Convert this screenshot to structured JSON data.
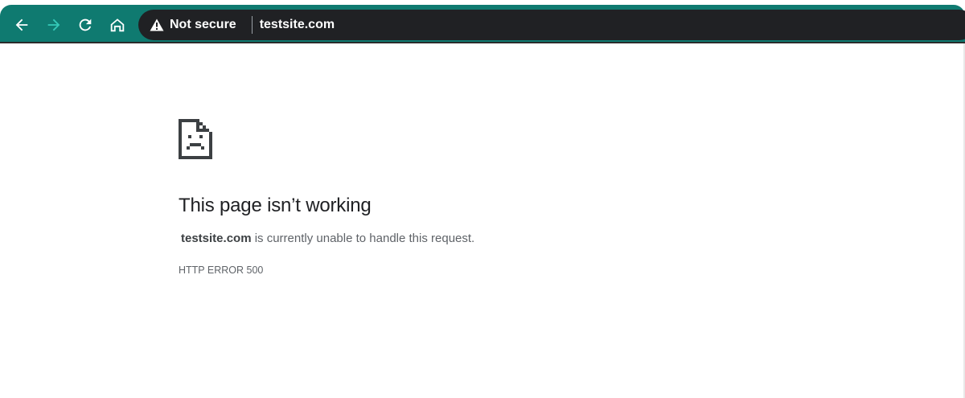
{
  "browser": {
    "nav": {
      "back_icon": "arrow-left-icon",
      "forward_icon": "arrow-right-icon",
      "reload_icon": "reload-icon",
      "home_icon": "home-icon"
    },
    "omnibox": {
      "security_label": "Not secure",
      "security_icon": "warning-triangle-icon",
      "url": "testsite.com"
    },
    "colors": {
      "toolbar": "#0f7a70",
      "forward_arrow": "#35c9b8",
      "omnibox": "#202124"
    }
  },
  "error": {
    "icon": "sad-page-icon",
    "title": "This page isn’t working",
    "host": "testsite.com",
    "message": " is currently unable to handle this request.",
    "code": "HTTP ERROR 500"
  }
}
